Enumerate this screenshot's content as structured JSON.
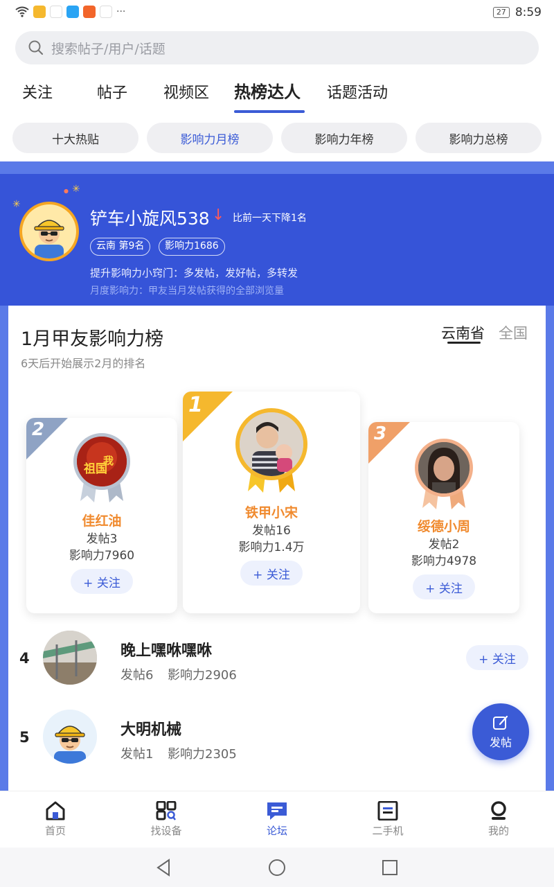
{
  "status_bar": {
    "battery": "27",
    "time": "8:59",
    "more": "···"
  },
  "search": {
    "placeholder": "搜索帖子/用户/话题"
  },
  "tabs": [
    {
      "label": "关注"
    },
    {
      "label": "帖子"
    },
    {
      "label": "视频区"
    },
    {
      "label": "热榜达人"
    },
    {
      "label": "话题活动"
    }
  ],
  "subtabs": [
    {
      "label": "十大热贴"
    },
    {
      "label": "影响力月榜"
    },
    {
      "label": "影响力年榜"
    },
    {
      "label": "影响力总榜"
    }
  ],
  "hero": {
    "name": "铲车小旋风538",
    "change": "比前一天下降1名",
    "badge_region": "云南  第9名",
    "badge_influence": "影响力1686",
    "tip": "提升影响力小窍门：多发帖，发好帖，多转发",
    "note": "月度影响力：甲友当月发帖获得的全部浏览量"
  },
  "board": {
    "title": "1月甲友影响力榜",
    "subtitle": "6天后开始展示2月的排名",
    "region_selected": "云南省",
    "region_other": "全国"
  },
  "podium": [
    {
      "rank": "1",
      "name": "铁甲小宋",
      "posts": "发帖16",
      "influence": "影响力1.4万",
      "follow": "+ 关注"
    },
    {
      "rank": "2",
      "name": "佳红油",
      "posts": "发帖3",
      "influence": "影响力7960",
      "follow": "+ 关注"
    },
    {
      "rank": "3",
      "name": "绥德小周",
      "posts": "发帖2",
      "influence": "影响力4978",
      "follow": "+ 关注"
    }
  ],
  "list": [
    {
      "rank": "4",
      "name": "晚上嘿咻嘿咻",
      "posts": "发帖6",
      "influence": "影响力2906",
      "follow": "+ 关注"
    },
    {
      "rank": "5",
      "name": "大明机械",
      "posts": "发帖1",
      "influence": "影响力2305"
    }
  ],
  "fab": {
    "label": "发帖"
  },
  "bottom_nav": [
    {
      "label": "首页"
    },
    {
      "label": "找设备"
    },
    {
      "label": "论坛"
    },
    {
      "label": "二手机"
    },
    {
      "label": "我的"
    }
  ],
  "colors": {
    "accent": "#3b5bd6",
    "hero_bg": "#3654d8",
    "gold": "#f5a623",
    "orange_name": "#f08a2e",
    "down_arrow": "#ff5a5a"
  }
}
